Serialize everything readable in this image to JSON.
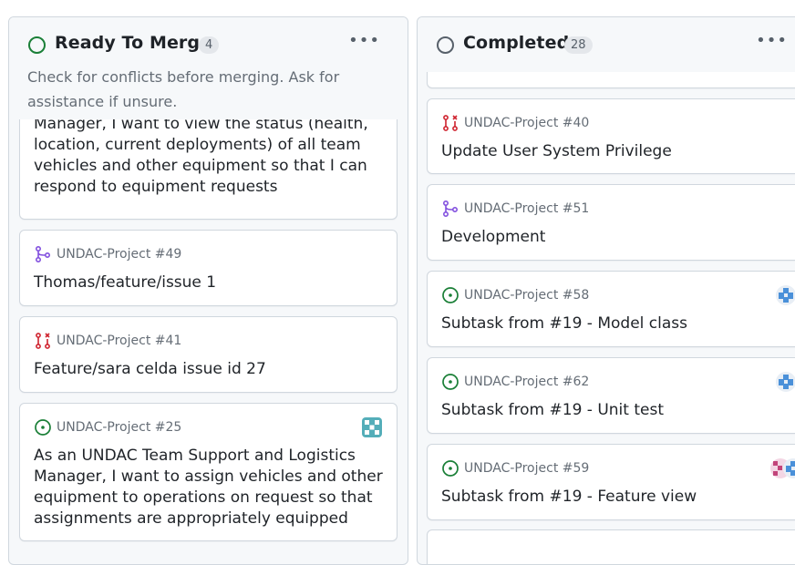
{
  "columns": [
    {
      "title": "Ready To Merge",
      "count": "4",
      "description": "Check for conflicts before merging. Ask for assistance if unsure.",
      "cards": [
        {
          "title": "Manager, I want to view the status (health, location, current deployments) of all team vehicles and other equipment so that I can respond to equipment requests"
        },
        {
          "type": "pull-request-draft",
          "ref": "UNDAC-Project #49",
          "title": "Thomas/feature/issue 1"
        },
        {
          "type": "pull-request-closed",
          "ref": "UNDAC-Project #41",
          "title": "Feature/sara celda issue id 27"
        },
        {
          "type": "issue-open",
          "ref": "UNDAC-Project #25",
          "title": "As an UNDAC Team Support and Logistics Manager, I want to assign vehicles and other equipment to operations on request so that assignments are appropriately equipped"
        }
      ]
    },
    {
      "title": "Completed",
      "count": "28",
      "cards": [
        {
          "type": "pull-request-closed",
          "ref": "UNDAC-Project #40",
          "title": "Update User System Privilege"
        },
        {
          "type": "pull-request-draft",
          "ref": "UNDAC-Project #51",
          "title": "Development"
        },
        {
          "type": "issue-open",
          "ref": "UNDAC-Project #58",
          "title": "Subtask from #19 - Model class"
        },
        {
          "type": "issue-open",
          "ref": "UNDAC-Project #62",
          "title": "Subtask from #19 - Unit test"
        },
        {
          "type": "issue-open",
          "ref": "UNDAC-Project #59",
          "title": "Subtask from #19 - Feature view"
        }
      ]
    }
  ],
  "colors": {
    "open": "#1a7f37",
    "closed_pr": "#cf222e",
    "draft_pr": "#8250df",
    "muted": "#656d76"
  }
}
